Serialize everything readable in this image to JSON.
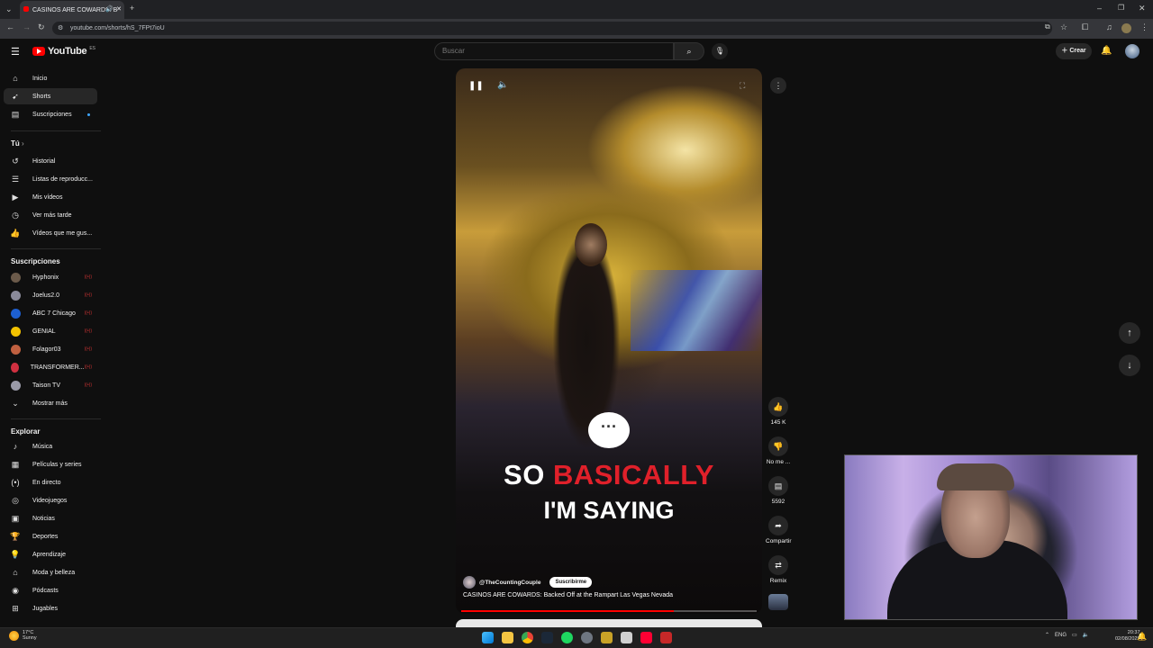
{
  "browser": {
    "tab_title": "CASINOS ARE COWARDS: B",
    "url": "youtube.com/shorts/hS_7FPt7ioU"
  },
  "header": {
    "logo_text": "YouTube",
    "country_code": "ES",
    "search_placeholder": "Buscar",
    "create_label": "Crear"
  },
  "sidebar": {
    "main": [
      {
        "label": "Inicio",
        "icon": "home-icon"
      },
      {
        "label": "Shorts",
        "icon": "shorts-icon"
      },
      {
        "label": "Suscripciones",
        "icon": "subscriptions-icon"
      }
    ],
    "you_heading": "Tú",
    "you_items": [
      {
        "label": "Historial",
        "icon": "history-icon"
      },
      {
        "label": "Listas de reproducc...",
        "icon": "playlist-icon"
      },
      {
        "label": "Mis vídeos",
        "icon": "video-icon"
      },
      {
        "label": "Ver más tarde",
        "icon": "clock-icon"
      },
      {
        "label": "Vídeos que me gus...",
        "icon": "thumb-up-icon"
      }
    ],
    "subs_heading": "Suscripciones",
    "subs": [
      {
        "label": "Hyphonix",
        "color": "#6b5a4a"
      },
      {
        "label": "Joelus2.0",
        "color": "#8a8a9a"
      },
      {
        "label": "ABC 7 Chicago",
        "color": "#1d5fd1"
      },
      {
        "label": "GENIAL",
        "color": "#f2c200"
      },
      {
        "label": "Folagor03",
        "color": "#c06040"
      },
      {
        "label": "TRANSFORMER...",
        "color": "#d03040"
      },
      {
        "label": "Taison TV",
        "color": "#9a9aa8"
      }
    ],
    "show_more": "Mostrar más",
    "explore_heading": "Explorar",
    "explore": [
      {
        "label": "Música",
        "icon": "music-icon"
      },
      {
        "label": "Películas y series",
        "icon": "film-icon"
      },
      {
        "label": "En directo",
        "icon": "live-icon"
      },
      {
        "label": "Videojuegos",
        "icon": "gamepad-icon"
      },
      {
        "label": "Noticias",
        "icon": "news-icon"
      },
      {
        "label": "Deportes",
        "icon": "trophy-icon"
      },
      {
        "label": "Aprendizaje",
        "icon": "bulb-icon"
      },
      {
        "label": "Moda y belleza",
        "icon": "hanger-icon"
      },
      {
        "label": "Pódcasts",
        "icon": "podcast-icon"
      },
      {
        "label": "Jugables",
        "icon": "grid-icon"
      }
    ]
  },
  "video": {
    "caption_word1": "SO",
    "caption_word2": "BASICALLY",
    "caption_line2": "I'M SAYING",
    "channel": "@TheCountingCouple",
    "subscribe_label": "Suscribirme",
    "title": "CASINOS ARE COWARDS: Backed Off at the Rampart Las Vegas Nevada",
    "progress": 0.72
  },
  "actions": {
    "likes": "145 K",
    "dislike_label": "No me ...",
    "comments": "5592",
    "share_label": "Compartir",
    "remix_label": "Remix"
  },
  "taskbar": {
    "temp": "17°C",
    "weather": "Sunny",
    "lang": "ENG",
    "time": "20:37",
    "date": "02/08/2025"
  },
  "colors": {
    "accent": "#ff0000",
    "caption_highlight": "#e0202a"
  }
}
